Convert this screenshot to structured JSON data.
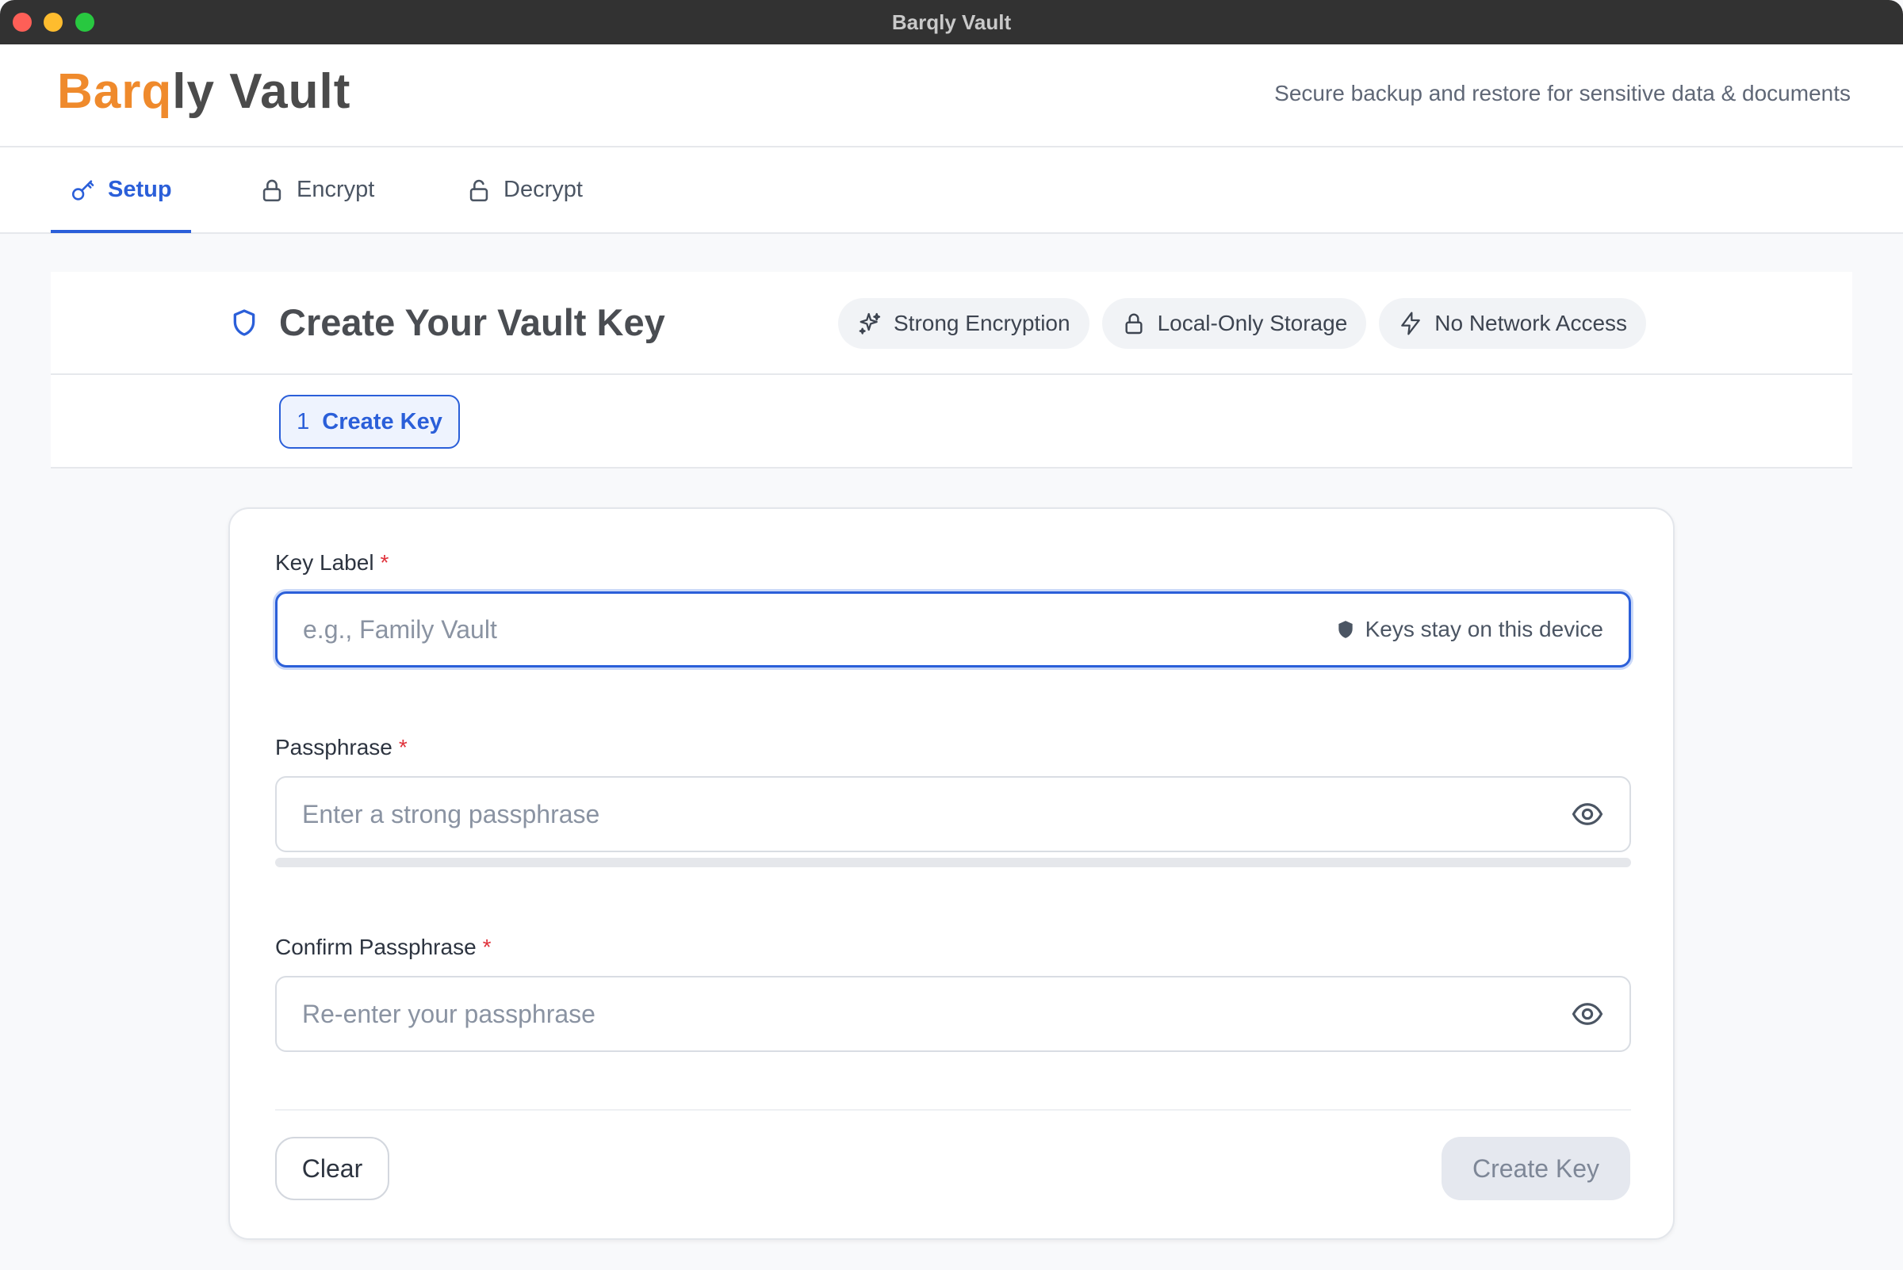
{
  "window": {
    "title": "Barqly Vault"
  },
  "header": {
    "logo_brand": "Barq",
    "logo_rest": "ly Vault",
    "tagline": "Secure backup and restore for sensitive data & documents"
  },
  "tabs": [
    {
      "label": "Setup",
      "icon": "key-icon",
      "active": true
    },
    {
      "label": "Encrypt",
      "icon": "lock-icon",
      "active": false
    },
    {
      "label": "Decrypt",
      "icon": "unlock-icon",
      "active": false
    }
  ],
  "panel": {
    "title": "Create Your Vault Key",
    "title_icon": "shield-icon",
    "chips": [
      {
        "label": "Strong Encryption",
        "icon": "sparkles-icon"
      },
      {
        "label": "Local-Only Storage",
        "icon": "lock-icon"
      },
      {
        "label": "No Network Access",
        "icon": "bolt-icon"
      }
    ],
    "step": {
      "number": "1",
      "label": "Create Key"
    }
  },
  "form": {
    "key_label": {
      "label": "Key Label",
      "required_mark": "*",
      "value": "",
      "placeholder": "e.g., Family Vault",
      "hint": "Keys stay on this device"
    },
    "passphrase": {
      "label": "Passphrase",
      "required_mark": "*",
      "value": "",
      "placeholder": "Enter a strong passphrase",
      "strength_fraction": 0
    },
    "confirm": {
      "label": "Confirm Passphrase",
      "required_mark": "*",
      "value": "",
      "placeholder": "Re-enter your passphrase"
    },
    "buttons": {
      "clear": "Clear",
      "create": "Create Key"
    }
  },
  "colors": {
    "accent": "#2b5fd9",
    "brand_orange": "#ef8a2c",
    "required": "#e0323b",
    "disabled_button_bg": "#e5e8ef"
  }
}
